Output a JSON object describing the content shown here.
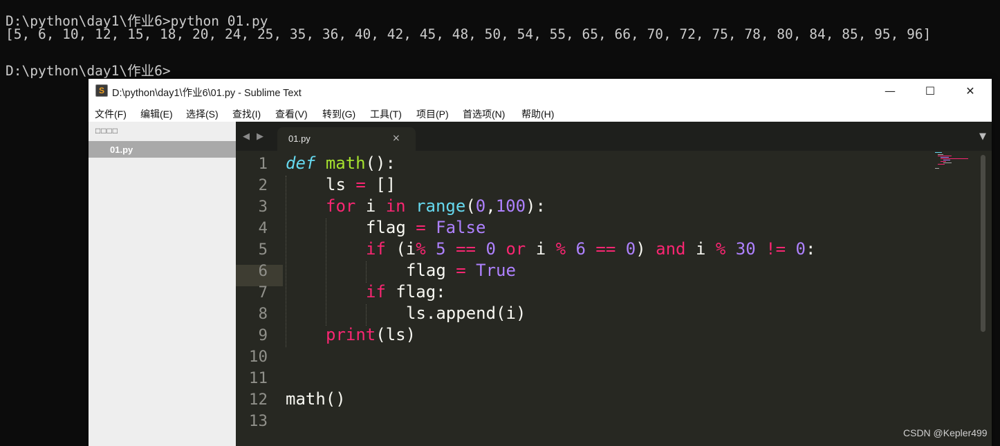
{
  "terminal": {
    "line1": "D:\\python\\day1\\作业6>python 01.py",
    "line2": "[5, 6, 10, 12, 15, 18, 20, 24, 25, 35, 36, 40, 42, 45, 48, 50, 54, 55, 65, 66, 70, 72, 75, 78, 80, 84, 85, 95, 96]",
    "line3": "D:\\python\\day1\\作业6>"
  },
  "window": {
    "title": "D:\\python\\day1\\作业6\\01.py - Sublime Text",
    "app_icon": "S",
    "minimize": "—",
    "maximize": "☐",
    "close": "✕"
  },
  "menu": [
    "文件(F)",
    "编辑(E)",
    "选择(S)",
    "查找(I)",
    "查看(V)",
    "转到(G)",
    "工具(T)",
    "项目(P)",
    "首选项(N)",
    "帮助(H)"
  ],
  "sidebar": {
    "header": "□□□□",
    "file": "01.py"
  },
  "tabs": {
    "left_arrow": "◀",
    "right_arrow": "▶",
    "active_tab": "01.py",
    "close": "×",
    "dropdown": "▼"
  },
  "editor": {
    "line_numbers": [
      "1",
      "2",
      "3",
      "4",
      "5",
      "6",
      "7",
      "8",
      "9",
      "10",
      "11",
      "12",
      "13"
    ],
    "active_line": 3,
    "code": {
      "l1": {
        "kw": "def",
        "fn": "math",
        "punct": "():"
      },
      "l2": {
        "var": "ls",
        "op": "=",
        "punct": "[]"
      },
      "l3": {
        "kw_for": "for",
        "var": "i",
        "kw_in": "in",
        "bi": "range",
        "p1": "(",
        "n0": "0",
        "comma": ",",
        "n100": "100",
        "p2": "):"
      },
      "l4": {
        "var": "flag",
        "op": "=",
        "const": "False"
      },
      "l5": {
        "kw_if": "if",
        "p1": "(i",
        "op1": "%",
        "n5": "5",
        "op2": "==",
        "n0a": "0",
        "kw_or": "or",
        "var_i": "i",
        "op3": "%",
        "n6": "6",
        "op4": "==",
        "n0b": "0",
        "p2": ")",
        "kw_and": "and",
        "var_i2": "i",
        "op5": "%",
        "n30": "30",
        "op6": "!=",
        "n0c": "0",
        "colon": ":"
      },
      "l6": {
        "var": "flag",
        "op": "=",
        "const": "True"
      },
      "l7": {
        "kw_if": "if",
        "rest": "flag:"
      },
      "l8": {
        "text": "ls.append(i)"
      },
      "l9": {
        "kw_print": "print",
        "rest": "(ls)"
      },
      "l12": {
        "text": "math()"
      }
    }
  },
  "watermark": "CSDN @Kepler499",
  "colors": {
    "background": "#272822",
    "keyword": "#f92672",
    "function": "#a6e22e",
    "builtin": "#66d9ef",
    "number": "#ae81ff",
    "text": "#f8f8f2"
  }
}
